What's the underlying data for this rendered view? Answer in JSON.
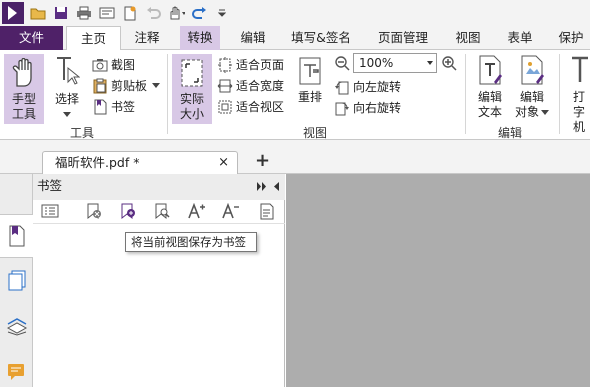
{
  "tabs": {
    "file": "文件",
    "home": "主页",
    "comment": "注释",
    "convert": "转换",
    "edit": "编辑",
    "fill_sign": "填写&签名",
    "page_manage": "页面管理",
    "view": "视图",
    "form": "表单",
    "protect": "保护"
  },
  "tools_group": {
    "label": "工具",
    "hand_tool_line1": "手型",
    "hand_tool_line2": "工具",
    "select_label": "选择",
    "screenshot_label": "截图",
    "clipboard_label": "剪贴板",
    "bookmark_label": "书签"
  },
  "view_group": {
    "label": "视图",
    "actual_size_line1": "实际",
    "actual_size_line2": "大小",
    "fit_page": "适合页面",
    "fit_width": "适合宽度",
    "fit_visible": "适合视区",
    "reflow": "重排",
    "zoom_value": "100%",
    "rotate_left": "向左旋转",
    "rotate_right": "向右旋转"
  },
  "edit_group": {
    "label": "编辑",
    "edit_text_line1": "编辑",
    "edit_text_line2": "文本",
    "edit_object_line1": "编辑",
    "edit_object_line2": "对象",
    "typewriter_line1": "打",
    "typewriter_line2": "字机"
  },
  "document_tab": {
    "title": "福昕软件.pdf *",
    "close": "×"
  },
  "bookmark_panel": {
    "title": "书签",
    "tooltip": "将当前视图保存为书签"
  },
  "colors": {
    "accent": "#4f2168",
    "highlight": "#d8c8e6",
    "canvas": "#adadad"
  }
}
